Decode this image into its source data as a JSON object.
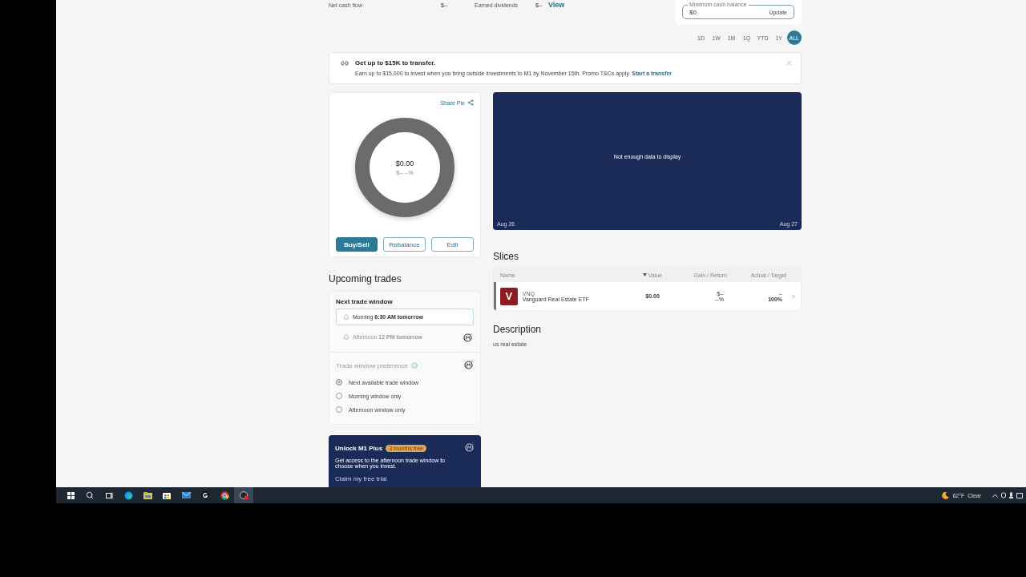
{
  "summary": {
    "items": [
      {
        "label": "Net cash flow",
        "value": "$--"
      },
      {
        "label": "Earned dividends",
        "value": "$--"
      }
    ],
    "link": "View"
  },
  "cash_card": {
    "label": "Minimum cash balance",
    "value": "$0",
    "action": "Update"
  },
  "ranges": [
    {
      "label": "1D",
      "selected": false
    },
    {
      "label": "1W",
      "selected": false
    },
    {
      "label": "1M",
      "selected": false
    },
    {
      "label": "1Q",
      "selected": false
    },
    {
      "label": "YTD",
      "selected": false
    },
    {
      "label": "1Y",
      "selected": false
    },
    {
      "label": "ALL",
      "selected": true
    }
  ],
  "promo": {
    "title": "Get up to $15K to transfer.",
    "text": "Earn up to $15,000 to invest when you bring outside investments to M1 by November 15th. Promo T&Cs apply.",
    "link": "Start a transfer"
  },
  "pie": {
    "share": "Share Pie",
    "value": "$0.00",
    "change": "$-- --%",
    "buttons": [
      {
        "label": "Buy/Sell",
        "kind": "primary"
      },
      {
        "label": "Rebalance",
        "kind": "outline"
      },
      {
        "label": "Edit",
        "kind": "outline"
      }
    ]
  },
  "upcoming": {
    "title": "Upcoming trades",
    "window_title": "Next trade window",
    "windows": [
      {
        "label": "Morning",
        "time": "6:30 AM tomorrow",
        "selected": true,
        "locked": false
      },
      {
        "label": "Afternoon",
        "time": "12 PM tomorrow",
        "selected": false,
        "locked": true
      }
    ],
    "preference_title": "Trade window preference",
    "options": [
      {
        "label": "Next available trade window",
        "selected": true
      },
      {
        "label": "Morning window only",
        "selected": false
      },
      {
        "label": "Afternoon window only",
        "selected": false
      }
    ]
  },
  "upsell": {
    "title": "Unlock M1 Plus",
    "badge": "3 months free",
    "text": "Get access to the afternoon trade window to choose when you invest.",
    "link": "Claim my free trial"
  },
  "chart": {
    "message": "Not enough data to display",
    "start": "Aug 26",
    "end": "Aug 27"
  },
  "slices": {
    "title": "Slices",
    "columns": [
      {
        "label": "Name",
        "sorted": false
      },
      {
        "label": "Value",
        "sorted": true
      },
      {
        "label": "Gain / Return",
        "sorted": false
      },
      {
        "label": "Actual / Target",
        "sorted": false
      }
    ],
    "rows": [
      {
        "logo": "V",
        "symbol": "VNQ",
        "name": "Vanguard Real Estate ETF",
        "value": "$0.00",
        "gain": "$--",
        "return": "--%",
        "actual": "--",
        "target": "100%"
      }
    ]
  },
  "description": {
    "title": "Description",
    "text": "us real estate"
  },
  "taskbar": {
    "weather": "62°F",
    "condition": "Clear"
  }
}
